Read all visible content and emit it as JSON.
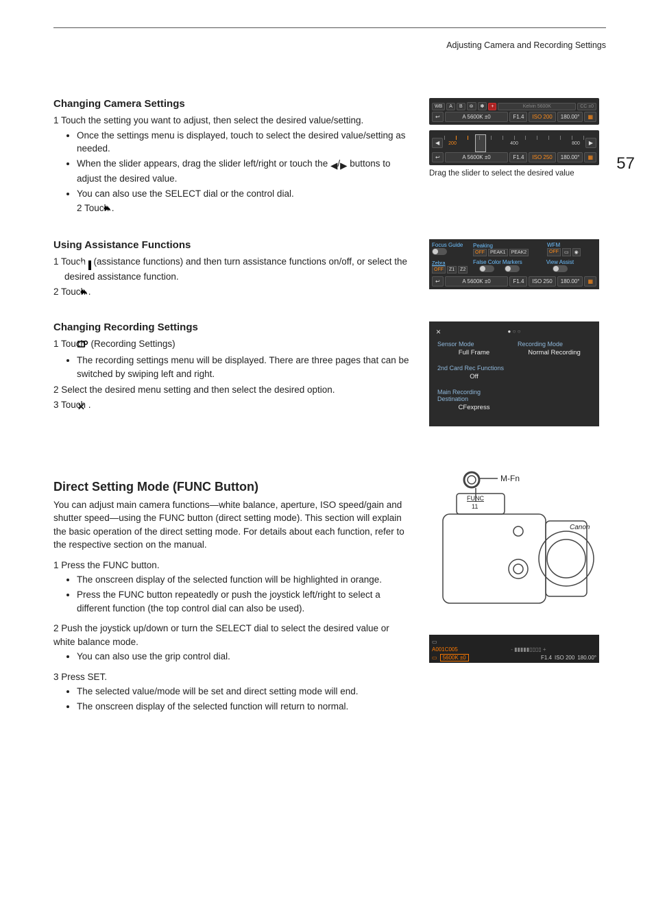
{
  "running_head": "Adjusting Camera and Recording Settings",
  "page_number": "57",
  "sec1": {
    "heading": "Changing Camera Settings",
    "step1": "1 Touch the setting you want to adjust, then select the desired value/setting.",
    "b1": "Once the settings menu is displayed, touch to select the desired value/setting as needed.",
    "b2a": "When the slider appears, drag the slider left/right or touch the ",
    "b2b": " buttons to adjust the desired value.",
    "b3": "You can also use the SELECT dial or the control dial.",
    "step2a": "2 Touch ",
    "step2b": "."
  },
  "fig1": {
    "chips_top": [
      "WB",
      "A",
      "B",
      "⊚",
      "✽",
      "+"
    ],
    "chips_top_dim": [
      "Kelvin 5600K",
      "CC ±0"
    ],
    "status": {
      "back": "↩",
      "wb": "A 5600K ±0",
      "ap": "F1.4",
      "iso": "ISO 200",
      "shut": "180.00°"
    },
    "slider": {
      "labels": [
        "200",
        "400",
        "800"
      ],
      "iso": "ISO 250"
    },
    "caption": "Drag the slider to select the desired value"
  },
  "sec2": {
    "heading": "Using Assistance Functions",
    "step1a": "1 Touch ",
    "step1b": " (assistance functions) and then turn assistance functions on/off, or select the desired assistance function.",
    "step2a": "2 Touch ",
    "step2b": "."
  },
  "fig2": {
    "heads": {
      "focus": "Focus Guide",
      "peaking": "Peaking",
      "wfm": "WFM"
    },
    "peak_btns": [
      "OFF",
      "PEAK1",
      "PEAK2"
    ],
    "wfm_btns": [
      "OFF",
      "▭",
      "◉"
    ],
    "heads2": {
      "zebra": "Zebra",
      "false": "False Color",
      "markers": "Markers",
      "view": "View Assist"
    },
    "zebra_btns": [
      "OFF",
      "Z1",
      "Z2"
    ],
    "status": {
      "back": "↩",
      "wb": "A 5600K ±0",
      "ap": "F1.4",
      "iso": "ISO 250",
      "shut": "180.00°"
    }
  },
  "sec3": {
    "heading": "Changing Recording Settings",
    "step1a": "1 Touch ",
    "step1b": " (Recording Settings)",
    "b1": "The recording settings menu will be displayed. There are three pages that can be switched by swiping left and right.",
    "step2": "2 Select the desired menu setting and then select the desired option.",
    "step3a": "3 Touch ",
    "step3b": "."
  },
  "fig3": {
    "close": "×",
    "items": [
      {
        "label": "Sensor Mode",
        "value": "Full Frame"
      },
      {
        "label": "Recording Mode",
        "value": "Normal Recording"
      },
      {
        "label": "2nd Card Rec Functions",
        "value": "Off"
      },
      {
        "label": "",
        "value": ""
      },
      {
        "label": "Main Recording Destination",
        "value": "CFexpress"
      },
      {
        "label": "",
        "value": ""
      }
    ]
  },
  "sec4": {
    "heading": "Direct Setting Mode (FUNC Button)",
    "intro": "You can adjust main camera functions—white balance, aperture, ISO speed/gain and shutter speed—using the FUNC button (direct setting mode). This section will explain the basic operation of the direct setting mode. For details about each function, refer to the respective section on the manual.",
    "s1": "1 Press the FUNC button.",
    "s1b1": "The onscreen display of the selected function will be highlighted in orange.",
    "s1b2": "Press the FUNC button repeatedly or push the joystick left/right to select a different function (the top control dial can also be used).",
    "s2": "2 Push the joystick up/down or turn the SELECT dial to select the desired value or white balance mode.",
    "s2b1": "You can also use the grip control dial.",
    "s3": "3 Press SET.",
    "s3b1": "The selected value/mode will be set and direct setting mode will end.",
    "s3b2": "The onscreen display of the selected function will return to normal."
  },
  "fig4": {
    "labels": {
      "mfn": "M-Fn",
      "func": "FUNC",
      "num": "11",
      "brand": "Canon"
    },
    "osd": {
      "clip": "A001C005",
      "wb": "5600K ±0",
      "ap": "F1.4",
      "iso": "ISO 200",
      "shut": "180.00°"
    }
  }
}
